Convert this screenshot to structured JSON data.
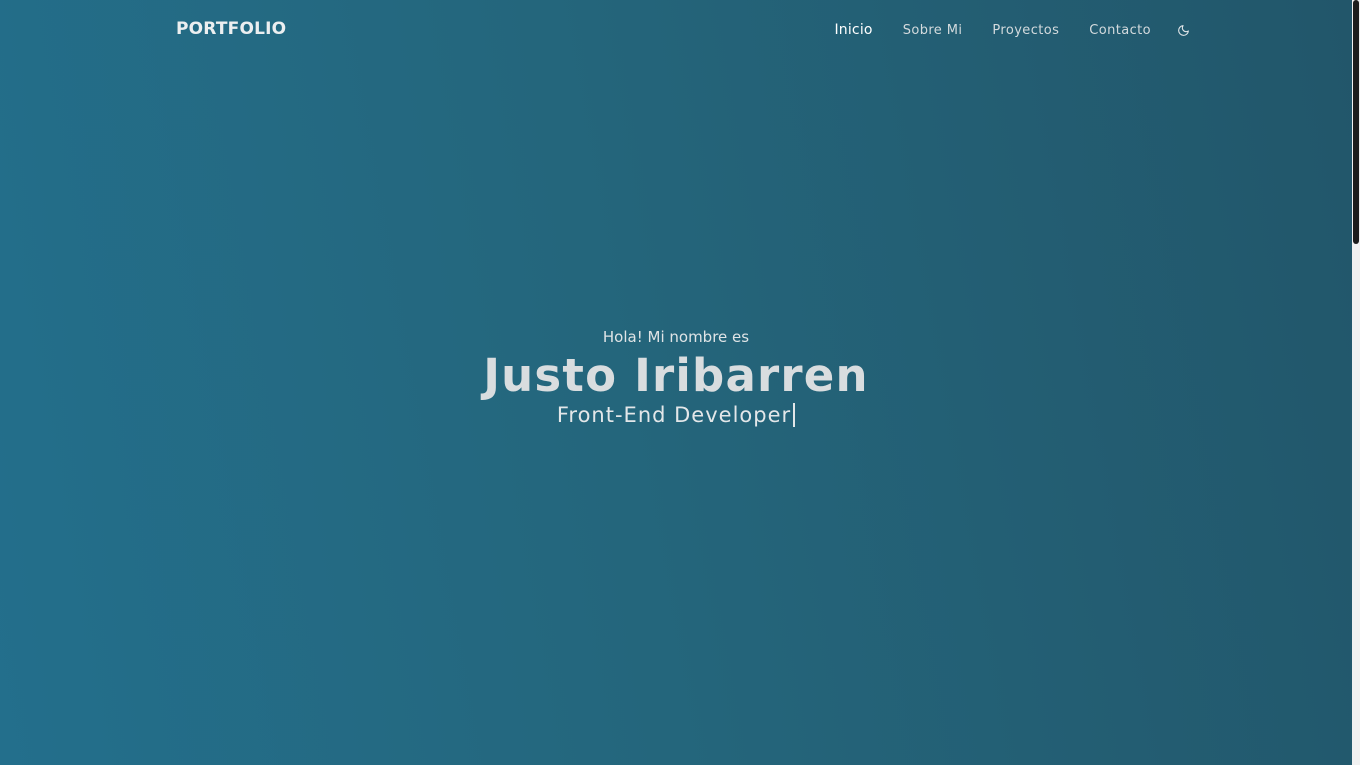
{
  "navbar": {
    "brand": "PORTFOLIO",
    "links": [
      {
        "label": "Inicio",
        "active": true
      },
      {
        "label": "Sobre Mi"
      },
      {
        "label": "Proyectos"
      },
      {
        "label": "Contacto"
      }
    ],
    "theme_toggle_icon": "moon-icon"
  },
  "hero": {
    "greeting": "Hola! Mi nombre es",
    "name": "Justo Iribarren",
    "role": "Front-End Developer"
  },
  "colors": {
    "background_start": "#236f8c",
    "background_end": "#22566a",
    "text": "#e7e9ea"
  }
}
